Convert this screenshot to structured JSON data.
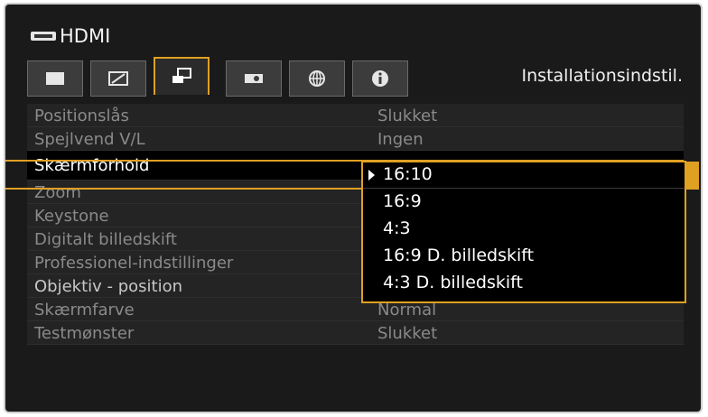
{
  "source": {
    "label": "HDMI",
    "icon": "hdmi-icon"
  },
  "tabs": [
    {
      "icon": "image-quality-icon"
    },
    {
      "icon": "image-adjust-icon"
    },
    {
      "icon": "installation-icon"
    },
    {
      "icon": "system-icon"
    },
    {
      "icon": "network-icon"
    },
    {
      "icon": "info-icon"
    }
  ],
  "active_tab_title": "Installationsindstil.",
  "menu": [
    {
      "label": "Positionslås",
      "value": "Slukket"
    },
    {
      "label": "Spejlvend V/L",
      "value": "Ingen"
    },
    {
      "label": "Skærmforhold",
      "value": ""
    },
    {
      "label": "Zoom",
      "value": ""
    },
    {
      "label": "Keystone",
      "value": ""
    },
    {
      "label": "Digitalt billedskift",
      "value": ""
    },
    {
      "label": "Professionel-indstillinger",
      "value": ""
    },
    {
      "label": "Objektiv - position",
      "value": ""
    },
    {
      "label": "Skærmfarve",
      "value": "Normal"
    },
    {
      "label": "Testmønster",
      "value": "Slukket"
    }
  ],
  "dropdown": {
    "options": [
      "16:10",
      "16:9",
      "4:3",
      "16:9 D. billedskift",
      "4:3 D. billedskift"
    ],
    "selected": "16:10"
  },
  "colors": {
    "accent": "#e0a022",
    "background": "#1a1a1a"
  }
}
